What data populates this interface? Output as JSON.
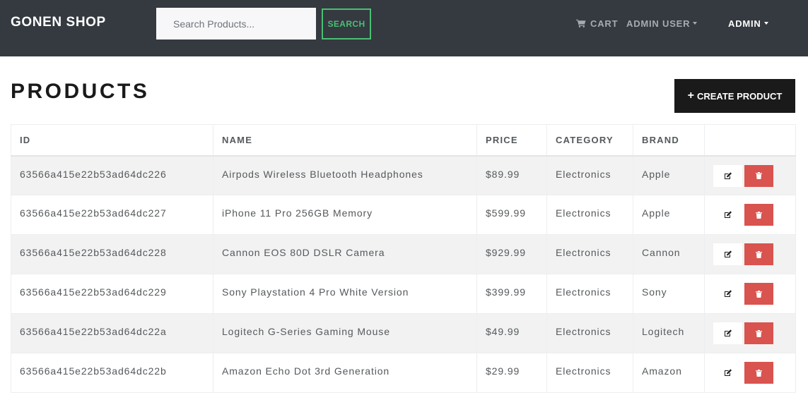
{
  "navbar": {
    "brand": "GONEN SHOP",
    "search": {
      "placeholder": "Search Products...",
      "button_label": "SEARCH"
    },
    "links": {
      "cart": "CART",
      "user": "ADMIN USER",
      "admin": "ADMIN"
    }
  },
  "page": {
    "title": "PRODUCTS",
    "create_button": "CREATE PRODUCT"
  },
  "table": {
    "headers": [
      "ID",
      "NAME",
      "PRICE",
      "CATEGORY",
      "BRAND",
      ""
    ],
    "rows": [
      {
        "id": "63566a415e22b53ad64dc226",
        "name": "Airpods Wireless Bluetooth Headphones",
        "price": "$89.99",
        "category": "Electronics",
        "brand": "Apple"
      },
      {
        "id": "63566a415e22b53ad64dc227",
        "name": "iPhone 11 Pro 256GB Memory",
        "price": "$599.99",
        "category": "Electronics",
        "brand": "Apple"
      },
      {
        "id": "63566a415e22b53ad64dc228",
        "name": "Cannon EOS 80D DSLR Camera",
        "price": "$929.99",
        "category": "Electronics",
        "brand": "Cannon"
      },
      {
        "id": "63566a415e22b53ad64dc229",
        "name": "Sony Playstation 4 Pro White Version",
        "price": "$399.99",
        "category": "Electronics",
        "brand": "Sony"
      },
      {
        "id": "63566a415e22b53ad64dc22a",
        "name": "Logitech G-Series Gaming Mouse",
        "price": "$49.99",
        "category": "Electronics",
        "brand": "Logitech"
      },
      {
        "id": "63566a415e22b53ad64dc22b",
        "name": "Amazon Echo Dot 3rd Generation",
        "price": "$29.99",
        "category": "Electronics",
        "brand": "Amazon"
      }
    ]
  },
  "icons": {
    "cart": "shopping-cart-icon",
    "create": "plus-icon",
    "edit": "edit-icon",
    "delete": "trash-icon",
    "dropdown": "caret-down-icon"
  },
  "colors": {
    "navbar": "#343a40",
    "search_button": "#4bbf73",
    "delete_button": "#d9534f",
    "create_button": "#1a1a1a"
  }
}
